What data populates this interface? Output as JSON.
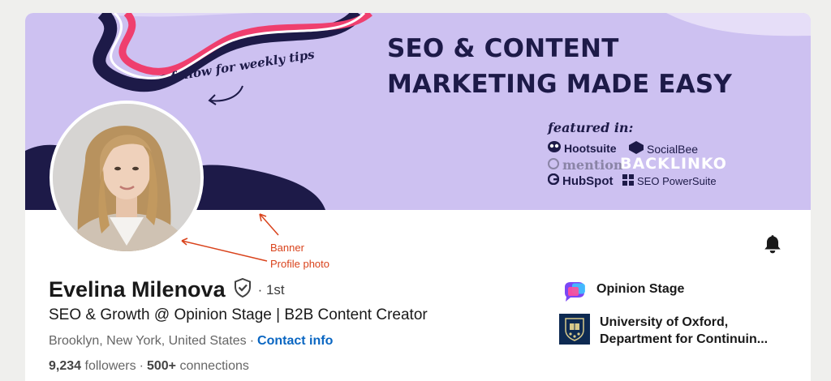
{
  "banner": {
    "headline_line1": "SEO & CONTENT",
    "headline_line2": "MARKETING MADE EASY",
    "tagline": "follow for weekly tips",
    "featured_title": "featured in:",
    "logos": {
      "hootsuite": "Hootsuite",
      "socialbee": "SocialBee",
      "mention": "mention",
      "backlinko": "BACKLINKO",
      "hubspot": "HubSpot",
      "seopowersuite": "SEO PowerSuite"
    },
    "colors": {
      "background": "#cdc1f1",
      "navy": "#1d1a48",
      "pink": "#ef3f6e"
    }
  },
  "annotations": {
    "banner": "Banner",
    "profile_photo": "Profile photo",
    "color": "#d9431c"
  },
  "profile": {
    "name": "Evelina Milenova",
    "degree": "· 1st",
    "headline": "SEO & Growth @ Opinion Stage | B2B Content Creator",
    "location": "Brooklyn, New York, United States",
    "separator": "·",
    "contact_info": "Contact info",
    "followers_count": "9,234",
    "followers_label": "followers",
    "connections_count": "500+",
    "connections_label": "connections"
  },
  "affiliations": [
    {
      "name": "Opinion Stage",
      "icon": "opinion-stage-logo-icon"
    },
    {
      "name": "University of Oxford, Department for Continuin...",
      "icon": "oxford-crest-icon"
    }
  ],
  "icons": {
    "notification": "bell-icon",
    "verified": "verified-shield-icon"
  },
  "colors": {
    "link": "#0a66c2",
    "text": "#191919",
    "muted": "#666666"
  }
}
